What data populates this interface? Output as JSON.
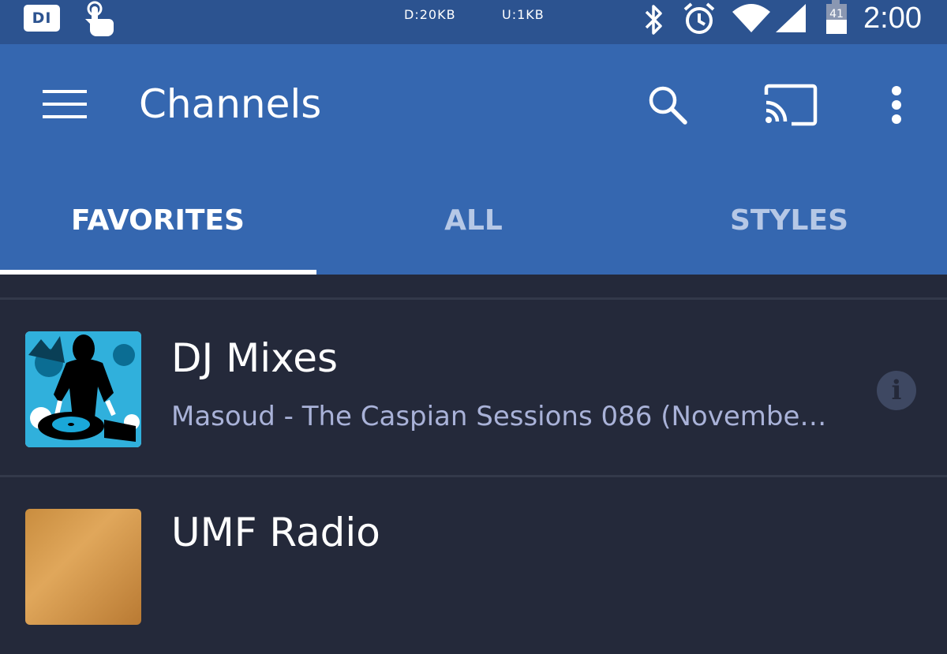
{
  "status_bar": {
    "app_badge": "DI",
    "download": "D:20KB",
    "upload": "U:1KB",
    "battery_level": "41",
    "time": "2:00"
  },
  "app_bar": {
    "title": "Channels",
    "icons": [
      "menu-icon",
      "search-icon",
      "cast-icon",
      "more-vert-icon"
    ]
  },
  "tabs": [
    {
      "label": "FAVORITES",
      "active": true
    },
    {
      "label": "ALL",
      "active": false
    },
    {
      "label": "STYLES",
      "active": false
    }
  ],
  "channels": [
    {
      "name": "DJ Mixes",
      "track": "Masoud - The Caspian Sessions 086 (Novembe…",
      "info_label": "i"
    },
    {
      "name": "UMF Radio",
      "track": "",
      "info_label": ""
    }
  ],
  "colors": {
    "status_bar": "#2c5390",
    "app_bar": "#3567b0",
    "background": "#24293a",
    "subtitle": "#a9b2d8"
  }
}
